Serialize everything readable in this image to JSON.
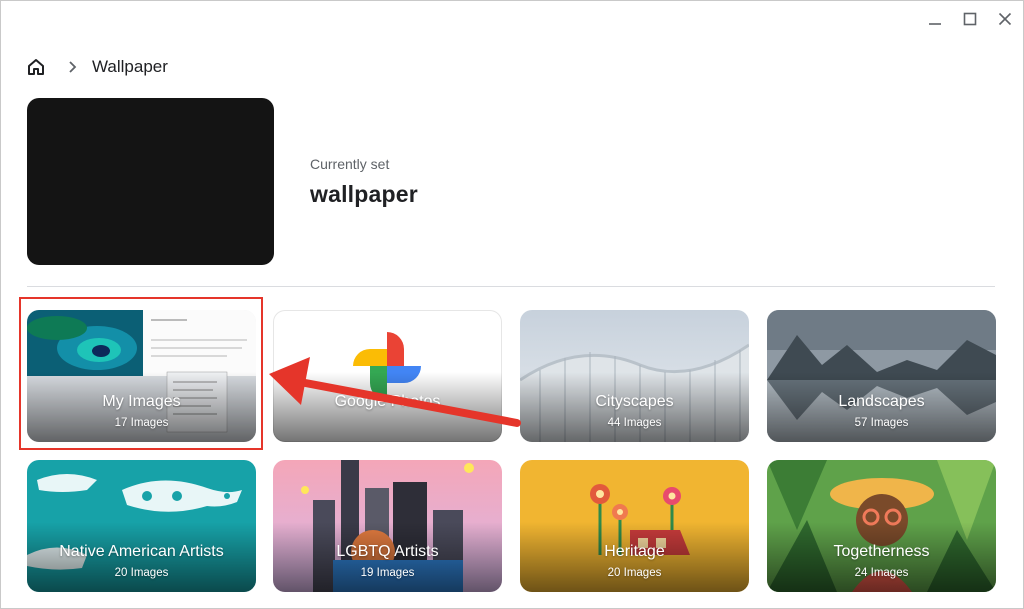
{
  "window": {
    "controls": [
      "minimize-icon",
      "maximize-icon",
      "close-icon"
    ]
  },
  "breadcrumb": {
    "home_icon": "home-icon",
    "separator_icon": "chevron-right-icon",
    "title": "Wallpaper"
  },
  "current": {
    "label": "Currently set",
    "name": "wallpaper"
  },
  "collections": [
    {
      "name": "My Images",
      "count": "17 Images"
    },
    {
      "name": "Google Photos",
      "count": ""
    },
    {
      "name": "Cityscapes",
      "count": "44 Images"
    },
    {
      "name": "Landscapes",
      "count": "57 Images"
    },
    {
      "name": "Native American Artists",
      "count": "20 Images"
    },
    {
      "name": "LGBTQ Artists",
      "count": "19 Images"
    },
    {
      "name": "Heritage",
      "count": "20 Images"
    },
    {
      "name": "Togetherness",
      "count": "24 Images"
    }
  ],
  "annotation": {
    "highlight_color": "#e5352a",
    "arrow_color": "#e5352a"
  },
  "colors": {
    "accent_red": "#e5352a",
    "text_primary": "#202124",
    "text_secondary": "#5f6368"
  }
}
